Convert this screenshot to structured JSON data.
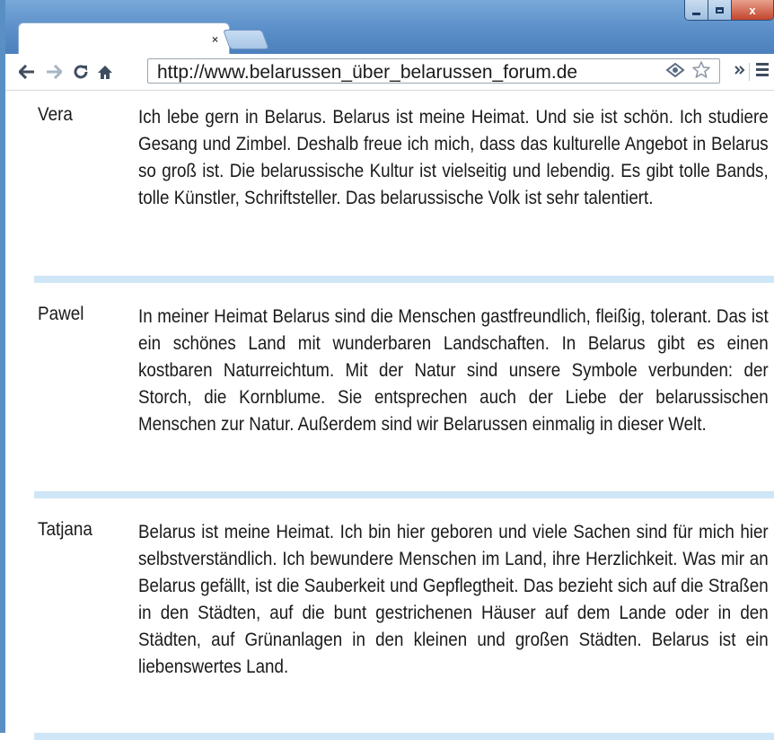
{
  "browser": {
    "tab": {
      "title": ""
    },
    "address_bar": {
      "url": "http://www.belarussen_über_belarussen_forum.de"
    },
    "icons": [
      "back-icon",
      "forward-icon",
      "reload-icon",
      "home-icon",
      "extension-icon",
      "bookmark-star-icon",
      "chevron-icon",
      "menu-icon"
    ],
    "close_glyph": "×",
    "window_close_glyph": "x"
  },
  "posts": [
    {
      "author": "Vera",
      "text": "Ich lebe gern in Belarus. Belarus ist meine Heimat. Und sie ist schön. Ich studiere Gesang und Zimbel. Deshalb freue ich mich, dass das kulturelle Angebot in Belarus so groß ist. Die belarussische Kultur ist vielseitig und lebendig. Es gibt tolle Bands, tolle Künstler, Schriftsteller. Das belarussische Volk ist sehr talentiert."
    },
    {
      "author": "Pawel",
      "text": "In meiner Heimat Belarus sind die Menschen gastfreundlich, fleißig, tolerant. Das ist ein schönes Land mit wunderbaren Landschaften. In Belarus gibt es einen kostbaren Naturreichtum. Mit der Natur sind unsere Symbole verbunden: der Storch, die Kornblume. Sie entsprechen auch der Liebe der belarussischen Menschen zur Natur. Außerdem sind wir Belarussen einmalig in dieser Welt."
    },
    {
      "author": "Tatjana",
      "text": "Belarus ist meine Heimat. Ich bin hier geboren und viele Sachen sind für mich hier selbstverständlich. Ich bewundere Menschen im Land, ihre Herzlichkeit. Was mir an Belarus gefällt, ist die Sauberkeit und Gepflegtheit. Das bezieht sich auf die Straßen in den Städten, auf die bunt gestrichenen Häuser auf dem Lande oder in den Städten, auf Grünanlagen in den kleinen und großen Städten. Belarus ist ein liebenswertes Land."
    }
  ],
  "colors": {
    "separator": "#cfe6f6",
    "window_frame": "#5a8fc4"
  }
}
